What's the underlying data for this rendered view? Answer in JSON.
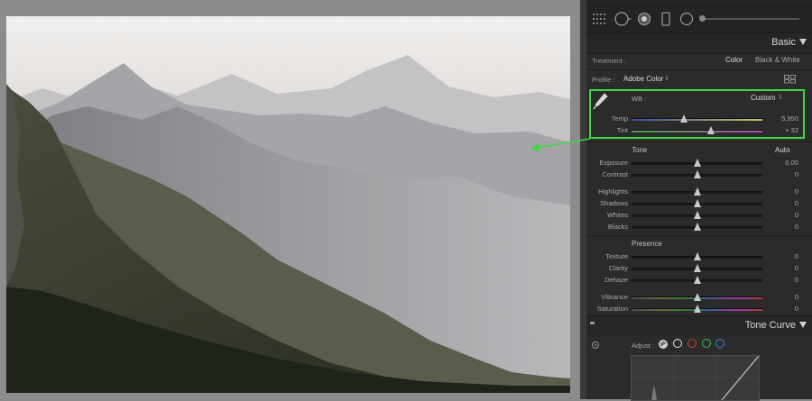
{
  "panel": {
    "basic_title": "Basic",
    "treatment": {
      "label": "Treatment :",
      "color": "Color",
      "bw": "Black & White"
    },
    "profile": {
      "label": "Profile :",
      "value": "Adobe Color",
      "chevron": "⇕"
    },
    "wb": {
      "label": "WB :",
      "value": "Custom",
      "chevron": "⇕"
    },
    "temp": {
      "label": "Temp",
      "value": "5,950",
      "level": 0.4
    },
    "tint": {
      "label": "Tint",
      "value": "+ 32",
      "level": 0.61
    },
    "tone": {
      "title": "Tone",
      "auto": "Auto"
    },
    "tone_sliders": [
      {
        "label": "Exposure",
        "value": "0.00",
        "level": 0.5
      },
      {
        "label": "Contrast",
        "value": "0",
        "level": 0.5
      },
      {
        "label": "Highlights",
        "value": "0",
        "level": 0.5
      },
      {
        "label": "Shadows",
        "value": "0",
        "level": 0.5
      },
      {
        "label": "Whites",
        "value": "0",
        "level": 0.5
      },
      {
        "label": "Blacks",
        "value": "0",
        "level": 0.5
      }
    ],
    "presence": {
      "title": "Presence"
    },
    "presence_sliders": [
      {
        "label": "Texture",
        "value": "0",
        "level": 0.5
      },
      {
        "label": "Clarity",
        "value": "0",
        "level": 0.5
      },
      {
        "label": "Dehaze",
        "value": "0",
        "level": 0.5
      },
      {
        "label": "Vibrance",
        "value": "0",
        "level": 0.5
      },
      {
        "label": "Saturation",
        "value": "0",
        "level": 0.5
      }
    ],
    "tone_curve_title": "Tone Curve",
    "adjust_label": "Adjust :"
  },
  "colors": {
    "highlight_box": "#3fd843",
    "curve_red": "#d63b3b",
    "curve_green": "#3fbf4a",
    "curve_blue": "#3b7fd6"
  },
  "icons": [
    "grid-icon",
    "brush-icon",
    "radial-icon",
    "mask-icon",
    "target-icon",
    "eyedropper-icon",
    "point-curve-icon"
  ]
}
